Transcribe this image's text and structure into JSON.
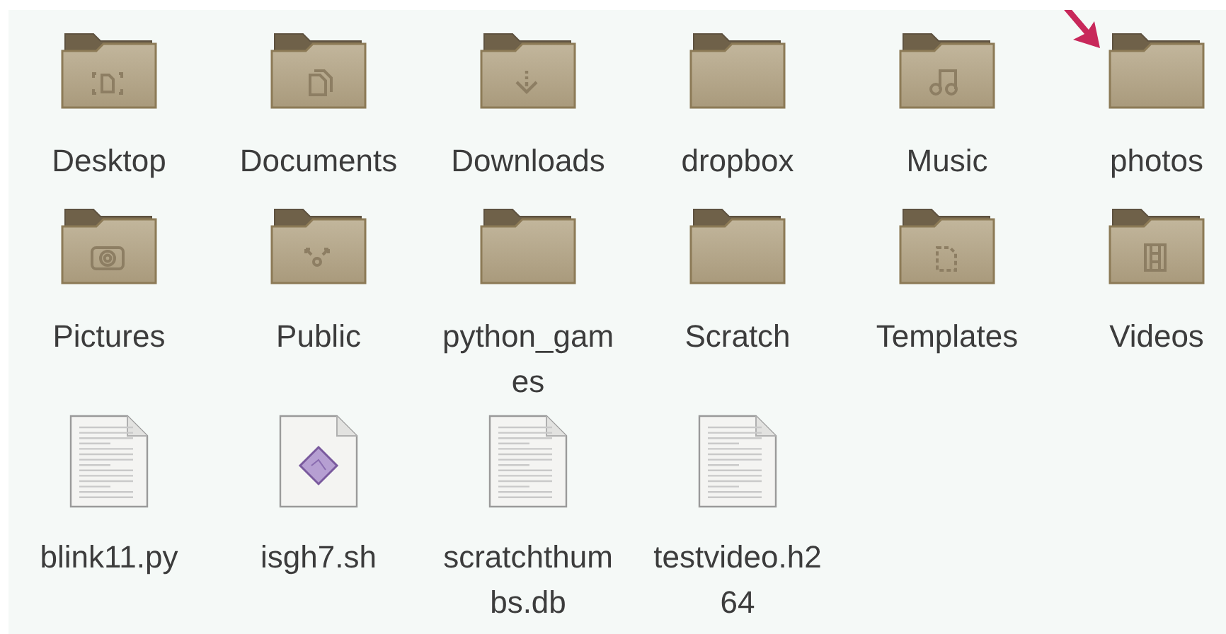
{
  "items": [
    {
      "label": "Desktop",
      "kind": "desktop-folder"
    },
    {
      "label": "Documents",
      "kind": "documents-folder"
    },
    {
      "label": "Downloads",
      "kind": "downloads-folder"
    },
    {
      "label": "dropbox",
      "kind": "folder"
    },
    {
      "label": "Music",
      "kind": "music-folder"
    },
    {
      "label": "photos",
      "kind": "folder"
    },
    {
      "label": "Pictures",
      "kind": "pictures-folder"
    },
    {
      "label": "Public",
      "kind": "public-folder"
    },
    {
      "label": "python_games",
      "kind": "folder"
    },
    {
      "label": "Scratch",
      "kind": "folder"
    },
    {
      "label": "Templates",
      "kind": "templates-folder"
    },
    {
      "label": "Videos",
      "kind": "videos-folder"
    },
    {
      "label": "blink11.py",
      "kind": "text-file"
    },
    {
      "label": "isgh7.sh",
      "kind": "script-file"
    },
    {
      "label": "scratchthumbs.db",
      "kind": "text-file"
    },
    {
      "label": "testvideo.h264",
      "kind": "text-file"
    }
  ]
}
